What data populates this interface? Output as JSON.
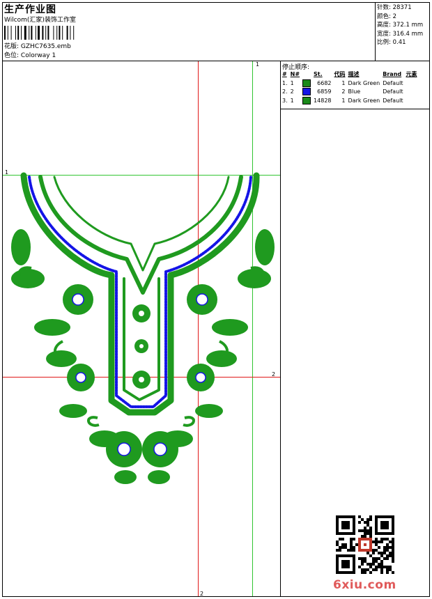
{
  "header": {
    "title": "生产作业图",
    "studio": "Wilcom(汇家)装饰工作室",
    "design_label": "花版:",
    "design_value": "GZHC7635.emb",
    "colorway_label": "色位:",
    "colorway_value": "Colorway 1"
  },
  "stats": [
    {
      "label": "针数:",
      "value": "28371"
    },
    {
      "label": "颜色:",
      "value": "2"
    },
    {
      "label": "高度:",
      "value": "372.1 mm"
    },
    {
      "label": "宽度:",
      "value": "316.4 mm"
    },
    {
      "label": "比例:",
      "value": "0.41"
    }
  ],
  "sequence": {
    "title": "停止顺序:",
    "headers": [
      "#",
      "N#",
      "St.",
      "代码",
      "描述",
      "Brand",
      "元素"
    ],
    "rows": [
      {
        "n": "1.",
        "needle": "1",
        "color": "#1a8a1a",
        "stitches": "6682",
        "code": "1",
        "desc": "Dark Green",
        "brand": "Default"
      },
      {
        "n": "2.",
        "needle": "2",
        "color": "#1414e6",
        "stitches": "6859",
        "code": "2",
        "desc": "Blue",
        "brand": "Default"
      },
      {
        "n": "3.",
        "needle": "1",
        "color": "#1a8a1a",
        "stitches": "14828",
        "code": "1",
        "desc": "Dark Green",
        "brand": "Default"
      }
    ]
  },
  "guides": {
    "green_label": "1",
    "red_label": "2"
  },
  "colors": {
    "thread_green": "#1f9a1f",
    "thread_blue": "#1414e6",
    "guide_green": "#31c431",
    "guide_red": "#e01818"
  },
  "watermark": "6xiu.com"
}
